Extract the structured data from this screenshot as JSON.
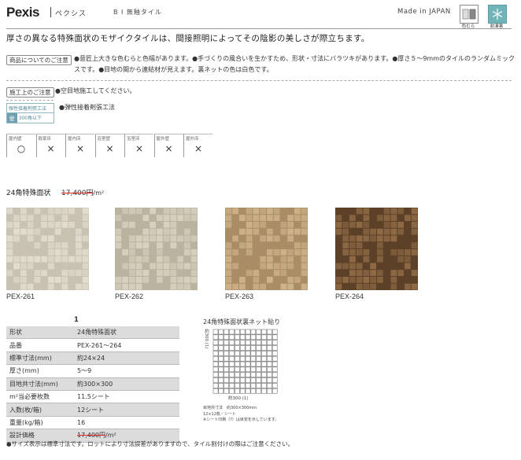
{
  "header": {
    "brand": "Pexis",
    "brand_kana": "ペクシス",
    "series": "B I 無釉タイル",
    "made_in": "Made in JAPAN",
    "icons": [
      {
        "name": "color-variation-icon",
        "label": "色むら"
      },
      {
        "name": "frost-resistant-icon",
        "label": "耐凍害",
        "color": "#6fb4b9"
      }
    ]
  },
  "intro": "厚さの異なる特殊面状のモザイクタイルは、間接照明によってその陰影の美しさが際立ちます。",
  "product_note": {
    "tag": "商品についてのご注意",
    "text": "●意匠上大きな色むらと色幅があります。●手づくりの風合いを生かすため、形状・寸法にバラツキがあります。●厚さ５～9mmのタイルのランダムミックスです。●目地の間から連結材が見えます。裏ネットの色は白色です。"
  },
  "construction_note": {
    "tag": "施工上のご注意",
    "text": "●空目地施工してください。"
  },
  "adhesive": {
    "title": "弾性接着剤張工法",
    "wall": "壁",
    "size": "300角以下",
    "note": "●弾性接着剤張工法"
  },
  "usage": [
    {
      "label": "屋内壁",
      "mark": "○"
    },
    {
      "label": "既家床",
      "mark": "×"
    },
    {
      "label": "屋内床",
      "mark": "×"
    },
    {
      "label": "浴室壁",
      "mark": "×"
    },
    {
      "label": "浴室床",
      "mark": "×"
    },
    {
      "label": "屋外壁",
      "mark": "×"
    },
    {
      "label": "屋外床",
      "mark": "×"
    }
  ],
  "price_line": {
    "title": "24角特殊面状",
    "price": "17,400円",
    "unit": "/m²"
  },
  "swatches": [
    {
      "code": "PEX-261",
      "color": "#e2ddcf",
      "shade": "#c8c2b2"
    },
    {
      "code": "PEX-262",
      "color": "#d7d2bf",
      "shade": "#b9b39f"
    },
    {
      "code": "PEX-263",
      "color": "#cdb28a",
      "shade": "#a88d66"
    },
    {
      "code": "PEX-264",
      "color": "#8f6a45",
      "shade": "#5c4128"
    }
  ],
  "spec_table": {
    "column": "1",
    "rows": [
      {
        "label": "形状",
        "value": "24角特殊面状"
      },
      {
        "label": "品番",
        "value": "PEX-261～264"
      },
      {
        "label": "標準寸法(mm)",
        "value": "約24×24"
      },
      {
        "label": "厚さ(mm)",
        "value": "5～9"
      },
      {
        "label": "目地共寸法(mm)",
        "value": "約300×300"
      },
      {
        "label": "m²当必要枚数",
        "value": "11.5シート"
      },
      {
        "label": "入数(枚/箱)",
        "value": "12シート"
      },
      {
        "label": "重量(kg/箱)",
        "value": "16"
      },
      {
        "label": "設計価格",
        "value": "17,400円",
        "unit": "/m²"
      }
    ]
  },
  "net_diagram": {
    "title": "24角特殊面状裏ネット貼り",
    "height_dim": "約300 (1)",
    "width_dim": "約300 (1)",
    "notes": [
      "目地共寸法　約300×300mm",
      "12×12枚／シート",
      "※シート印刷（?）は目安を示しています。"
    ]
  },
  "footnote": "●サイズ表示は標準寸法です。ロットにより寸法誤差がありますので、タイル割付けの際はご注意ください。"
}
